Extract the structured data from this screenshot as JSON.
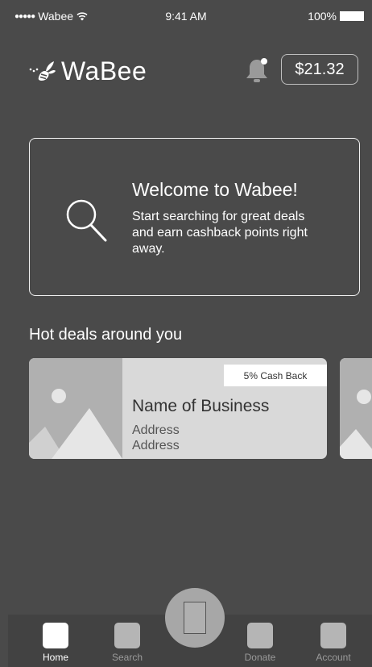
{
  "status_bar": {
    "signal": "●●●●●",
    "carrier": "Wabee",
    "time": "9:41 AM",
    "battery": "100%"
  },
  "header": {
    "logo_text": "WaBee",
    "balance": "$21.32"
  },
  "welcome": {
    "title": "Welcome to Wabee!",
    "body": "Start searching for great deals and earn cashback points right away."
  },
  "deals": {
    "section_title": "Hot deals around you",
    "items": [
      {
        "cashback": "5% Cash Back",
        "name": "Name of Business",
        "address_1": "Address",
        "address_2": "Address"
      }
    ]
  },
  "tabs": [
    {
      "label": "Home",
      "icon": "home-icon",
      "active": true
    },
    {
      "label": "Search",
      "icon": "search-icon",
      "active": false
    },
    {
      "label": "Donate",
      "icon": "donate-icon",
      "active": false
    },
    {
      "label": "Account",
      "icon": "account-icon",
      "active": false
    }
  ],
  "colors": {
    "background": "#4a4a4a",
    "tab_bar": "#424242",
    "card": "#d9d9d9",
    "placeholder": "#b0b0b0"
  }
}
